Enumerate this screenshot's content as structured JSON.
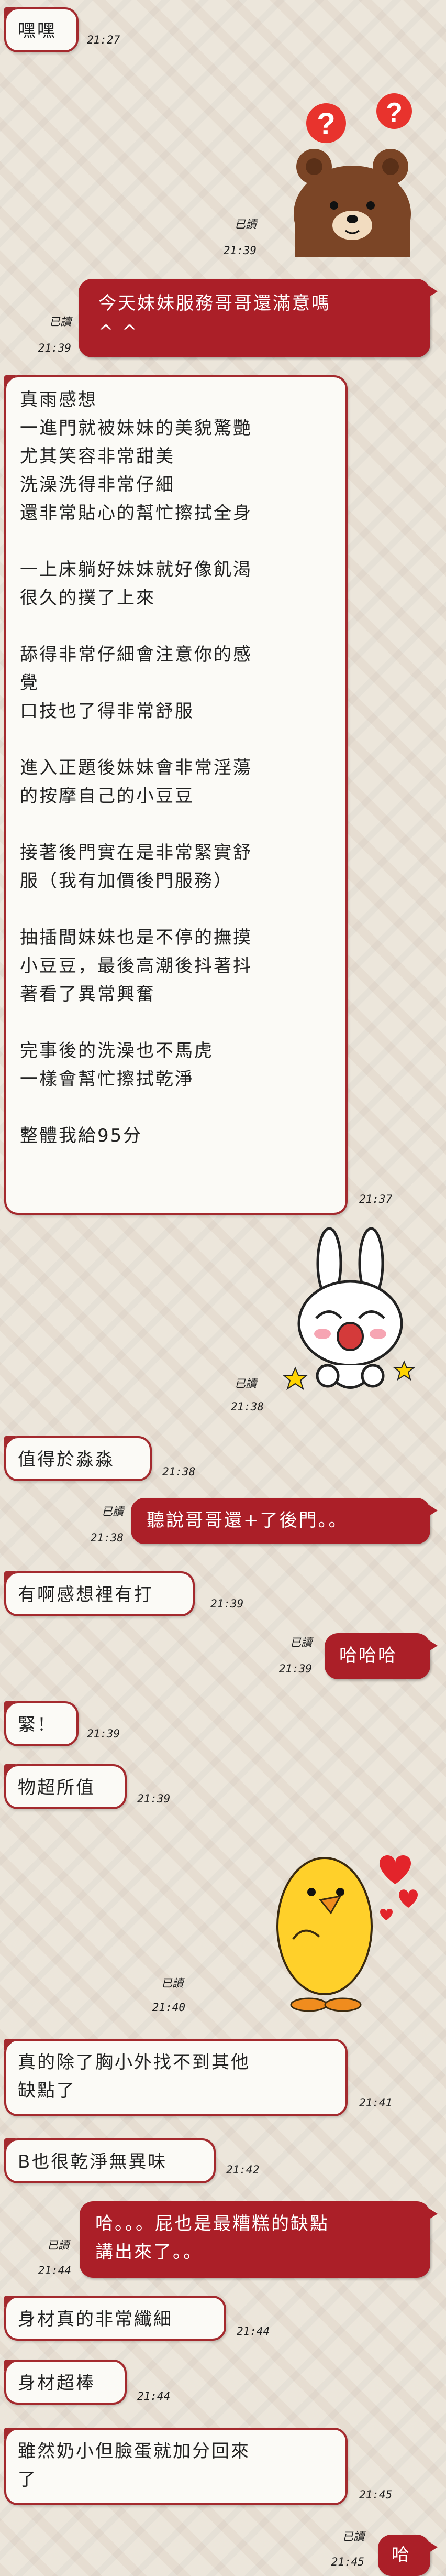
{
  "read_label": "已讀",
  "messages": [
    {
      "text": "嘿嘿",
      "time": "21:27"
    },
    {
      "time": "21:39"
    },
    {
      "text": "今天妹妹服務哥哥還滿意嗎\n^ ^",
      "time": "21:39"
    },
    {
      "text": "真雨感想\n一進門就被妹妹的美貌驚艷\n尤其笑容非常甜美\n洗澡洗得非常仔細\n還非常貼心的幫忙擦拭全身\n\n一上床躺好妹妹就好像飢渴\n很久的撲了上來\n\n舔得非常仔細會注意你的感\n覺\n口技也了得非常舒服\n\n進入正題後妹妹會非常淫蕩\n的按摩自己的小豆豆\n\n接著後門實在是非常緊實舒\n服（我有加價後門服務）\n\n抽插間妹妹也是不停的撫摸\n小豆豆，最後高潮後抖著抖\n著看了異常興奮\n\n完事後的洗澡也不馬虎\n一樣會幫忙擦拭乾淨\n\n整體我給95分",
      "time": "21:37"
    },
    {
      "time": "21:38"
    },
    {
      "text": "值得於淼淼",
      "time": "21:38"
    },
    {
      "text": "聽說哥哥還+了後門。。",
      "time": "21:38"
    },
    {
      "text": "有啊感想裡有打",
      "time": "21:39"
    },
    {
      "text": "哈哈哈",
      "time": "21:39"
    },
    {
      "text": "緊！",
      "time": "21:39"
    },
    {
      "text": "物超所值",
      "time": "21:39"
    },
    {
      "time": "21:40"
    },
    {
      "text": "真的除了胸小外找不到其他\n缺點了",
      "time": "21:41"
    },
    {
      "text": "B也很乾淨無異味",
      "time": "21:42"
    },
    {
      "text": "哈。。。屁也是最糟糕的缺點\n講出來了。。",
      "time": "21:44"
    },
    {
      "text": "身材真的非常纖細",
      "time": "21:44"
    },
    {
      "text": "身材超棒",
      "time": "21:44"
    },
    {
      "text": "雖然奶小但臉蛋就加分回來\n了",
      "time": "21:45"
    },
    {
      "text": "哈",
      "time": "21:45"
    }
  ]
}
